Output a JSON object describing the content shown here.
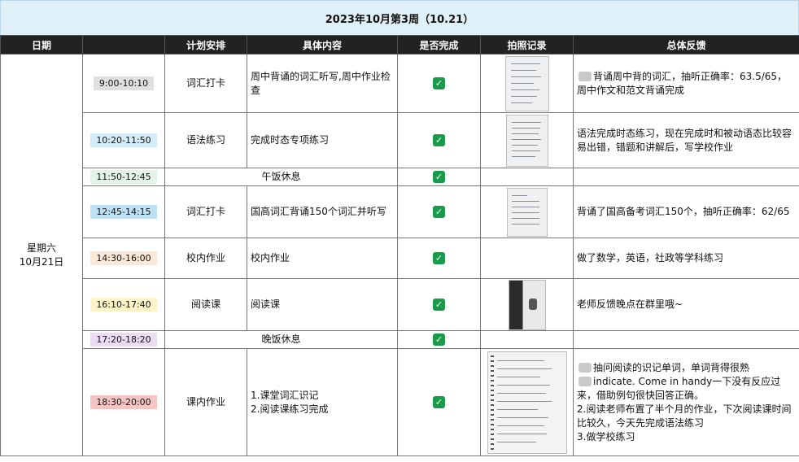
{
  "title": "2023年10月第3周（10.21）",
  "headers": [
    "日期",
    "计划安排",
    "具体内容",
    "是否完成",
    "拍照记录",
    "总体反馈"
  ],
  "date": {
    "weekday": "星期六",
    "day": "10月21日"
  },
  "rows": [
    {
      "time": "9:00-10:10",
      "time_color": "#e0e0e0",
      "plan": "词汇打卡",
      "content": "周中背诵的词汇听写,周中作业检查",
      "done": "✓",
      "has_photo": true,
      "feedback": "背诵周中背的词汇，抽听正确率：63.5/65，周中作文和范文背诵完成"
    },
    {
      "time": "10:20-11:50",
      "time_color": "#d3ecf8",
      "plan": "语法练习",
      "content": "完成时态专项练习",
      "done": "✓",
      "has_photo": true,
      "feedback": "语法完成时态练习，现在完成时和被动语态比较容易出错，错题和讲解后，写学校作业"
    },
    {
      "time": "11:50-12:45",
      "time_color": "#e3f4e6",
      "plan": "",
      "content": "午饭休息",
      "done": "✓",
      "has_photo": false,
      "feedback": "",
      "merged": true
    },
    {
      "time": "12:45-14:15",
      "time_color": "#bfe1f4",
      "plan": "词汇打卡",
      "content": "国高词汇背诵150个词汇并听写",
      "done": "✓",
      "has_photo": true,
      "feedback": "背诵了国高备考词汇150个，抽听正确率：62/65"
    },
    {
      "time": "14:30-16:00",
      "time_color": "#fbe8d6",
      "plan": "校内作业",
      "content": "校内作业",
      "done": "✓",
      "has_photo": false,
      "feedback": "做了数学，英语，社政等学科练习"
    },
    {
      "time": "16:10-17:40",
      "time_color": "#fdf3c8",
      "plan": "阅读课",
      "content": "阅读课",
      "done": "✓",
      "has_photo": true,
      "feedback": "老师反馈晚点在群里哦~"
    },
    {
      "time": "17:20-18:20",
      "time_color": "#eadcf5",
      "plan": "",
      "content": "晚饭休息",
      "done": "✓",
      "has_photo": false,
      "feedback": "",
      "merged": true
    },
    {
      "time": "18:30-20:00",
      "time_color": "#f7c4c4",
      "plan": "课内作业",
      "content_lines": [
        "1.课堂词汇识记",
        "2.阅读课练习完成"
      ],
      "done": "✓",
      "has_photo": true,
      "feedback_lines": [
        "抽问阅读的识记单词，单词背得很熟",
        "indicate. Come in handy一下没有反应过",
        "来，借助例句很快回答正确。",
        "2.阅读老师布置了半个月的作业，下次阅读课时间",
        "比较久，今天先完成语法练习",
        "3.做学校练习"
      ]
    }
  ],
  "colors": {
    "header_bg": "#222222",
    "title_bg": "#dff0f8",
    "check": "#1a9b4b"
  }
}
